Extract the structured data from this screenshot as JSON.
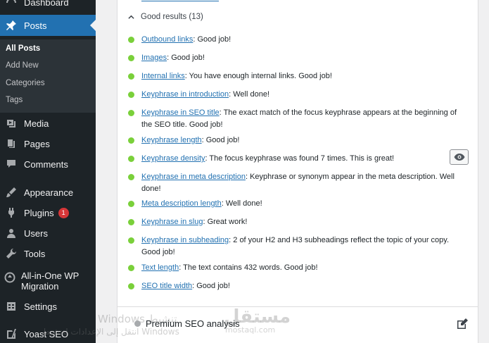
{
  "sidebar": {
    "top_item": "Dashboard",
    "posts_label": "Posts",
    "submenu": [
      "All Posts",
      "Add New",
      "Categories",
      "Tags"
    ],
    "items": [
      {
        "label": "Media",
        "icon": "media-icon"
      },
      {
        "label": "Pages",
        "icon": "pages-icon"
      },
      {
        "label": "Comments",
        "icon": "comments-icon"
      },
      {
        "label": "Appearance",
        "icon": "appearance-icon"
      },
      {
        "label": "Plugins",
        "icon": "plugins-icon",
        "badge": "1"
      },
      {
        "label": "Users",
        "icon": "users-icon"
      },
      {
        "label": "Tools",
        "icon": "tools-icon"
      },
      {
        "label": "All-in-One WP Migration",
        "icon": "migration-icon"
      },
      {
        "label": "Settings",
        "icon": "settings-icon"
      },
      {
        "label": "Yoast SEO",
        "icon": "yoast-icon"
      }
    ]
  },
  "seo": {
    "header": "Good results (13)",
    "results": [
      {
        "link": "Outbound links",
        "text": ": Good job!"
      },
      {
        "link": "Images",
        "text": ": Good job!"
      },
      {
        "link": "Internal links",
        "text": ": You have enough internal links. Good job!"
      },
      {
        "link": "Keyphrase in introduction",
        "text": ": Well done!"
      },
      {
        "link": "Keyphrase in SEO title",
        "text": ": The exact match of the focus keyphrase appears at the beginning of the SEO title. Good job!"
      },
      {
        "link": "Keyphrase length",
        "text": ": Good job!"
      },
      {
        "link": "Keyphrase density",
        "text": ": The focus keyphrase was found 7 times. This is great!"
      },
      {
        "link": "Keyphrase in meta description",
        "text": ": Keyphrase or synonym appear in the meta description. Well done!"
      },
      {
        "link": "Meta description length",
        "text": ": Well done!"
      },
      {
        "link": "Keyphrase in slug",
        "text": ": Great work!"
      },
      {
        "link": "Keyphrase in subheading",
        "text": ": 2 of your H2 and H3 subheadings reflect the topic of your copy. Good job!"
      },
      {
        "link": "Text length",
        "text": ": The text contains 432 words. Good job!"
      },
      {
        "link": "SEO title width",
        "text": ": Good job!"
      }
    ],
    "premium_label": "Premium SEO analysis"
  },
  "watermark": {
    "line1": "Windows تنشيط",
    "line2": "انتقل إلى الإعدادات لتنشيط Windows",
    "logo": "مستقل",
    "site": "mostaql.com"
  },
  "colors": {
    "sidebar_bg": "#1d2327",
    "accent": "#2271b1",
    "good": "#7ad03a",
    "badge": "#d63638"
  }
}
